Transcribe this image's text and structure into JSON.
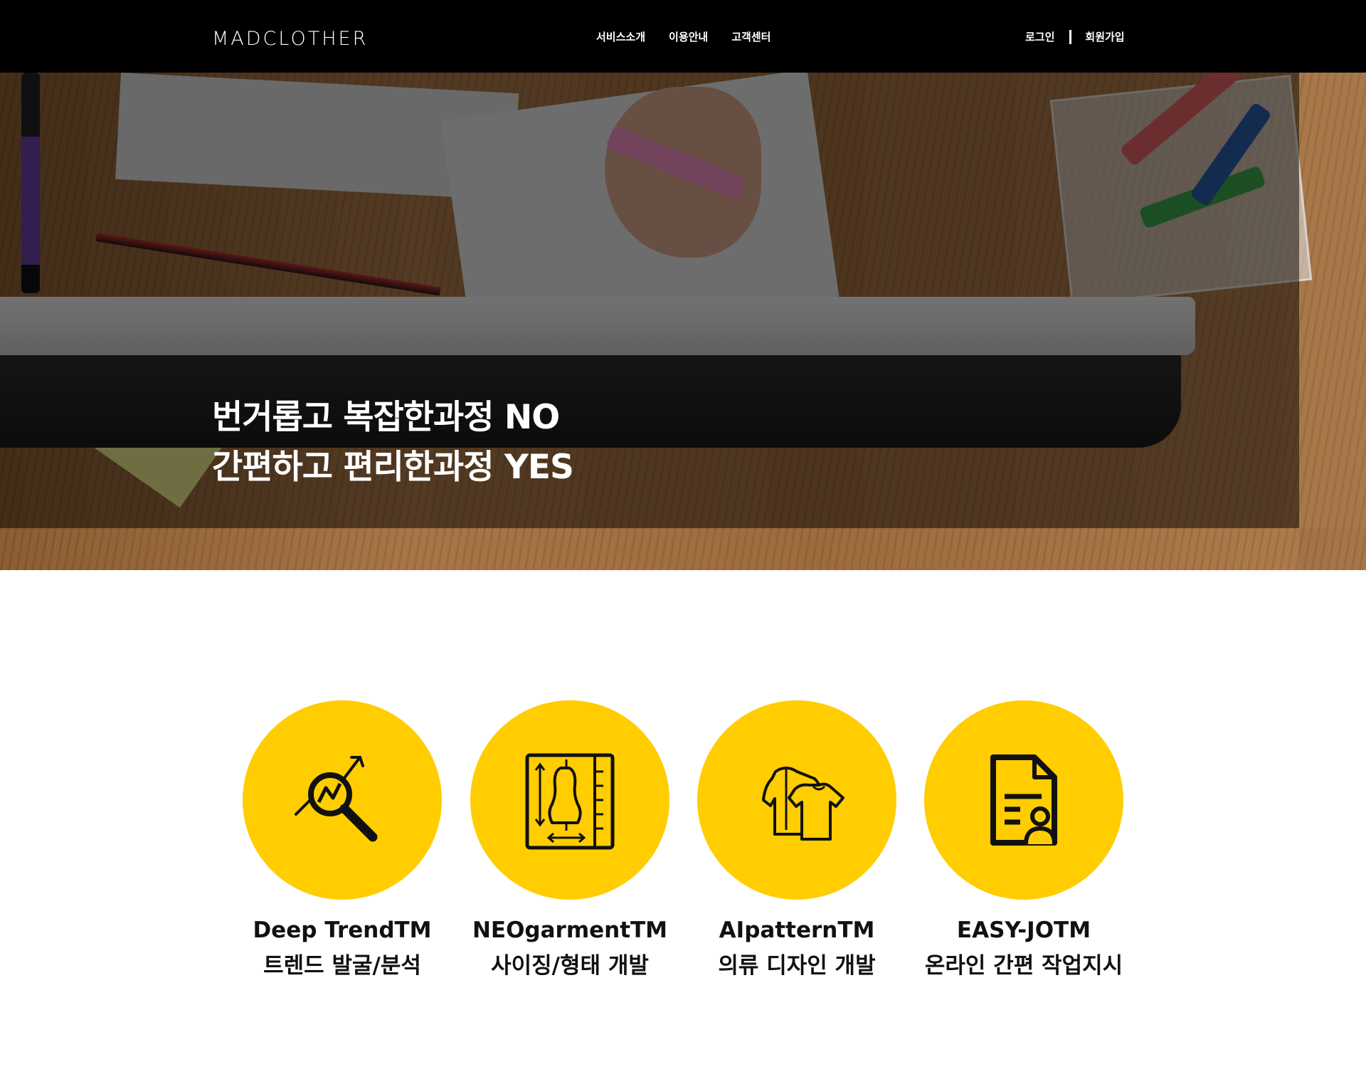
{
  "header": {
    "logo": "MADCLOTHER",
    "nav": [
      {
        "label": "서비스소개"
      },
      {
        "label": "이용안내"
      },
      {
        "label": "고객센터"
      }
    ],
    "login": "로그인",
    "signup": "회원가입"
  },
  "hero": {
    "line1": "번거롭고 복잡한과정 NO",
    "line2": "간편하고 편리한과정 YES"
  },
  "services": [
    {
      "name": "Deep TrendTM",
      "desc": "트렌드 발굴/분석",
      "icon": "trend-search-icon"
    },
    {
      "name": "NEOgarmentTM",
      "desc": "사이징/형태 개발",
      "icon": "mannequin-sizing-icon"
    },
    {
      "name": "AIpatternTM",
      "desc": "의류 디자인 개발",
      "icon": "clothing-design-icon"
    },
    {
      "name": "EASY-JOTM",
      "desc": "온라인 간편 작업지시",
      "icon": "document-user-icon"
    }
  ],
  "colors": {
    "header_bg": "#000000",
    "accent_yellow": "#ffcd00",
    "text_dark": "#111111"
  }
}
